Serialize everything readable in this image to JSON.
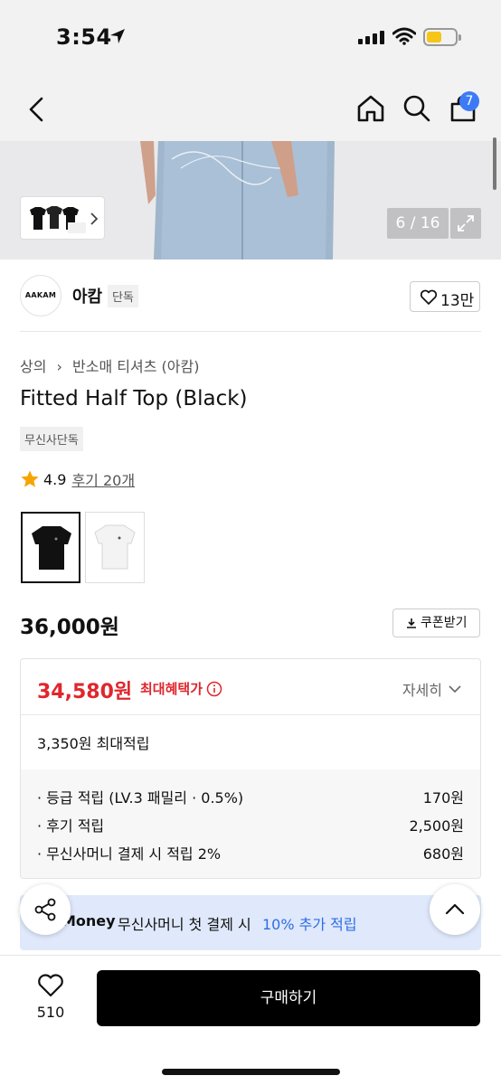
{
  "status_bar": {
    "time": "3:54"
  },
  "nav": {
    "cart_count": "7"
  },
  "gallery": {
    "counter": "6 / 16"
  },
  "brand": {
    "logo_text": "AAKAM",
    "name": "아캄",
    "tag": "단독",
    "likes": "13만"
  },
  "product": {
    "breadcrumb": [
      "상의",
      "반소매 티셔츠 (아캄)"
    ],
    "title": "Fitted Half Top (Black)",
    "badge": "무신사단독",
    "rating": "4.9",
    "reviews": "후기 20개",
    "price": "36,000원",
    "coupon_label": "쿠폰받기"
  },
  "benefit": {
    "sale_price": "34,580원",
    "max_benefit_label": "최대혜택가",
    "detail_label": "자세히",
    "points_total": "3,350원 최대적립",
    "points": [
      {
        "label": "· 등급 적립 (LV.3 패밀리 · 0.5%)",
        "value": "170원"
      },
      {
        "label": "· 후기 적립",
        "value": "2,500원"
      },
      {
        "label": "· 무신사머니 결제 시 적립 2%",
        "value": "680원"
      }
    ]
  },
  "banner": {
    "brand": "Money",
    "text": "무신사머니 첫 결제 시",
    "highlight": "10% 추가 적립"
  },
  "bottom_bar": {
    "wish_count": "510",
    "buy_label": "구매하기"
  },
  "colors": {
    "accent_red": "#e0262d",
    "accent_blue": "#2f6ce5",
    "badge_blue": "#3d7bf6"
  }
}
